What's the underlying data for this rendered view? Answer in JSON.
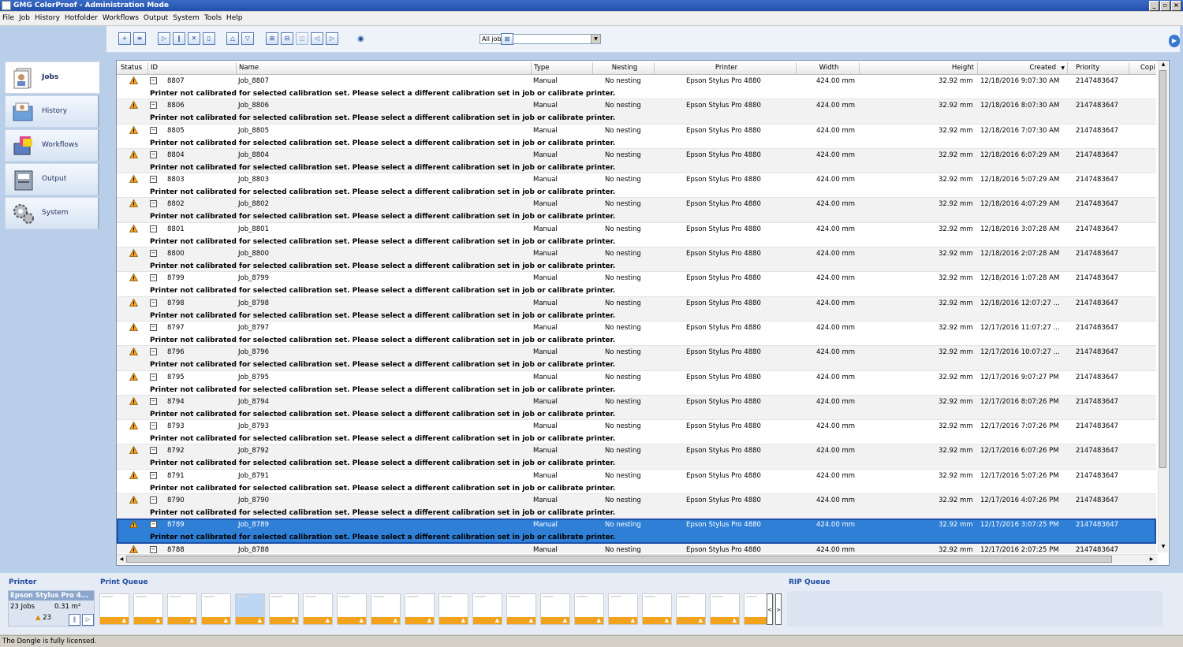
{
  "window": {
    "title": "GMG ColorProof - Administration Mode"
  },
  "menu": [
    "File",
    "Job",
    "History",
    "Hotfolder",
    "Workflows",
    "Output",
    "System",
    "Tools",
    "Help"
  ],
  "filter": {
    "selected": "All jobs"
  },
  "sidebar": {
    "items": [
      {
        "label": "Jobs",
        "icon": "jobs-icon"
      },
      {
        "label": "History",
        "icon": "history-icon"
      },
      {
        "label": "Workflows",
        "icon": "workflows-icon"
      },
      {
        "label": "Output",
        "icon": "output-icon"
      },
      {
        "label": "System",
        "icon": "system-icon"
      }
    ]
  },
  "table": {
    "columns": [
      "Status",
      "ID",
      "Name",
      "Type",
      "Nesting",
      "Printer",
      "Width",
      "Height",
      "Created",
      "Priority",
      "Copi"
    ],
    "message": "Printer not calibrated for selected calibration set. Please select a different calibration set in job or calibrate printer.",
    "rows": [
      {
        "id": "8807",
        "name": "Job_8807",
        "type": "Manual",
        "nesting": "No nesting",
        "printer": "Epson Stylus Pro 4880",
        "width": "424.00 mm",
        "height": "32.92 mm",
        "created": "12/18/2016 9:07:30 AM",
        "priority": "2147483647"
      },
      {
        "id": "8806",
        "name": "Job_8806",
        "type": "Manual",
        "nesting": "No nesting",
        "printer": "Epson Stylus Pro 4880",
        "width": "424.00 mm",
        "height": "32.92 mm",
        "created": "12/18/2016 8:07:30 AM",
        "priority": "2147483647"
      },
      {
        "id": "8805",
        "name": "Job_8805",
        "type": "Manual",
        "nesting": "No nesting",
        "printer": "Epson Stylus Pro 4880",
        "width": "424.00 mm",
        "height": "32.92 mm",
        "created": "12/18/2016 7:07:30 AM",
        "priority": "2147483647"
      },
      {
        "id": "8804",
        "name": "Job_8804",
        "type": "Manual",
        "nesting": "No nesting",
        "printer": "Epson Stylus Pro 4880",
        "width": "424.00 mm",
        "height": "32.92 mm",
        "created": "12/18/2016 6:07:29 AM",
        "priority": "2147483647"
      },
      {
        "id": "8803",
        "name": "Job_8803",
        "type": "Manual",
        "nesting": "No nesting",
        "printer": "Epson Stylus Pro 4880",
        "width": "424.00 mm",
        "height": "32.92 mm",
        "created": "12/18/2016 5:07:29 AM",
        "priority": "2147483647"
      },
      {
        "id": "8802",
        "name": "Job_8802",
        "type": "Manual",
        "nesting": "No nesting",
        "printer": "Epson Stylus Pro 4880",
        "width": "424.00 mm",
        "height": "32.92 mm",
        "created": "12/18/2016 4:07:29 AM",
        "priority": "2147483647"
      },
      {
        "id": "8801",
        "name": "Job_8801",
        "type": "Manual",
        "nesting": "No nesting",
        "printer": "Epson Stylus Pro 4880",
        "width": "424.00 mm",
        "height": "32.92 mm",
        "created": "12/18/2016 3:07:28 AM",
        "priority": "2147483647"
      },
      {
        "id": "8800",
        "name": "Job_8800",
        "type": "Manual",
        "nesting": "No nesting",
        "printer": "Epson Stylus Pro 4880",
        "width": "424.00 mm",
        "height": "32.92 mm",
        "created": "12/18/2016 2:07:28 AM",
        "priority": "2147483647"
      },
      {
        "id": "8799",
        "name": "Job_8799",
        "type": "Manual",
        "nesting": "No nesting",
        "printer": "Epson Stylus Pro 4880",
        "width": "424.00 mm",
        "height": "32.92 mm",
        "created": "12/18/2016 1:07:28 AM",
        "priority": "2147483647"
      },
      {
        "id": "8798",
        "name": "Job_8798",
        "type": "Manual",
        "nesting": "No nesting",
        "printer": "Epson Stylus Pro 4880",
        "width": "424.00 mm",
        "height": "32.92 mm",
        "created": "12/18/2016 12:07:27 ...",
        "priority": "2147483647"
      },
      {
        "id": "8797",
        "name": "Job_8797",
        "type": "Manual",
        "nesting": "No nesting",
        "printer": "Epson Stylus Pro 4880",
        "width": "424.00 mm",
        "height": "32.92 mm",
        "created": "12/17/2016 11:07:27 ...",
        "priority": "2147483647"
      },
      {
        "id": "8796",
        "name": "Job_8796",
        "type": "Manual",
        "nesting": "No nesting",
        "printer": "Epson Stylus Pro 4880",
        "width": "424.00 mm",
        "height": "32.92 mm",
        "created": "12/17/2016 10:07:27 ...",
        "priority": "2147483647"
      },
      {
        "id": "8795",
        "name": "Job_8795",
        "type": "Manual",
        "nesting": "No nesting",
        "printer": "Epson Stylus Pro 4880",
        "width": "424.00 mm",
        "height": "32.92 mm",
        "created": "12/17/2016 9:07:27 PM",
        "priority": "2147483647"
      },
      {
        "id": "8794",
        "name": "Job_8794",
        "type": "Manual",
        "nesting": "No nesting",
        "printer": "Epson Stylus Pro 4880",
        "width": "424.00 mm",
        "height": "32.92 mm",
        "created": "12/17/2016 8:07:26 PM",
        "priority": "2147483647"
      },
      {
        "id": "8793",
        "name": "Job_8793",
        "type": "Manual",
        "nesting": "No nesting",
        "printer": "Epson Stylus Pro 4880",
        "width": "424.00 mm",
        "height": "32.92 mm",
        "created": "12/17/2016 7:07:26 PM",
        "priority": "2147483647"
      },
      {
        "id": "8792",
        "name": "Job_8792",
        "type": "Manual",
        "nesting": "No nesting",
        "printer": "Epson Stylus Pro 4880",
        "width": "424.00 mm",
        "height": "32.92 mm",
        "created": "12/17/2016 6:07:26 PM",
        "priority": "2147483647"
      },
      {
        "id": "8791",
        "name": "Job_8791",
        "type": "Manual",
        "nesting": "No nesting",
        "printer": "Epson Stylus Pro 4880",
        "width": "424.00 mm",
        "height": "32.92 mm",
        "created": "12/17/2016 5:07:26 PM",
        "priority": "2147483647"
      },
      {
        "id": "8790",
        "name": "Job_8790",
        "type": "Manual",
        "nesting": "No nesting",
        "printer": "Epson Stylus Pro 4880",
        "width": "424.00 mm",
        "height": "32.92 mm",
        "created": "12/17/2016 4:07:26 PM",
        "priority": "2147483647"
      },
      {
        "id": "8789",
        "name": "Job_8789",
        "type": "Manual",
        "nesting": "No nesting",
        "printer": "Epson Stylus Pro 4880",
        "width": "424.00 mm",
        "height": "32.92 mm",
        "created": "12/17/2016 3:07:25 PM",
        "priority": "2147483647",
        "selected": true
      },
      {
        "id": "8788",
        "name": "Job_8788",
        "type": "Manual",
        "nesting": "No nesting",
        "printer": "Epson Stylus Pro 4880",
        "width": "424.00 mm",
        "height": "32.92 mm",
        "created": "12/17/2016 2:07:25 PM",
        "priority": "2147483647"
      }
    ]
  },
  "bottom": {
    "printer_label": "Printer",
    "print_queue_label": "Print Queue",
    "rip_queue_label": "RIP Queue",
    "printer_name": "Epson Stylus Pro 4...",
    "jobs": "23 Jobs",
    "area": "0.31 m²",
    "warnings": "23",
    "queue_count": 20,
    "queue_selected_index": 4
  },
  "status": {
    "text": "The Dongle is fully licensed."
  },
  "colors": {
    "accent": "#2f7fd6",
    "warning": "#f3a21e",
    "panel": "#b9cfe9"
  }
}
